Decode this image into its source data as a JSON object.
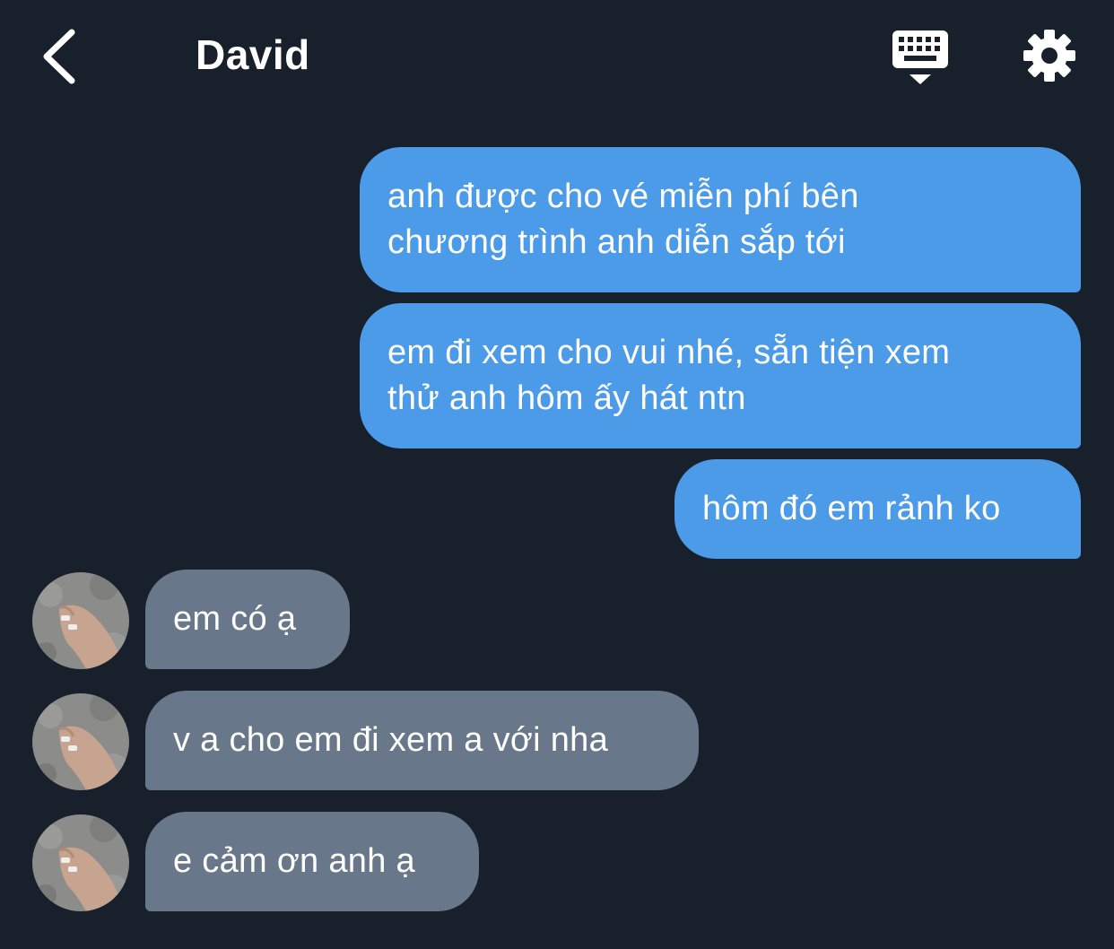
{
  "header": {
    "title": "David",
    "back_icon": "chevron-left-icon",
    "keyboard_icon": "keyboard-icon",
    "settings_icon": "gear-icon"
  },
  "colors": {
    "background": "#18202c",
    "outgoing_bubble": "#4c9be8",
    "incoming_bubble": "#68778a",
    "text": "#ffffff"
  },
  "messages": {
    "outgoing": [
      {
        "line1": "anh được cho vé miễn phí bên",
        "line2": "chương trình anh diễn sắp tới"
      },
      {
        "line1": "em đi xem cho vui nhé, sẵn tiện xem",
        "line2": "thử anh hôm ấy hát ntn"
      },
      {
        "line1": "hôm đó em rảnh ko"
      }
    ],
    "incoming": [
      {
        "text": "em có ạ"
      },
      {
        "text": "v a cho em đi xem a với nha"
      },
      {
        "text": "e cảm ơn anh ạ"
      }
    ]
  }
}
